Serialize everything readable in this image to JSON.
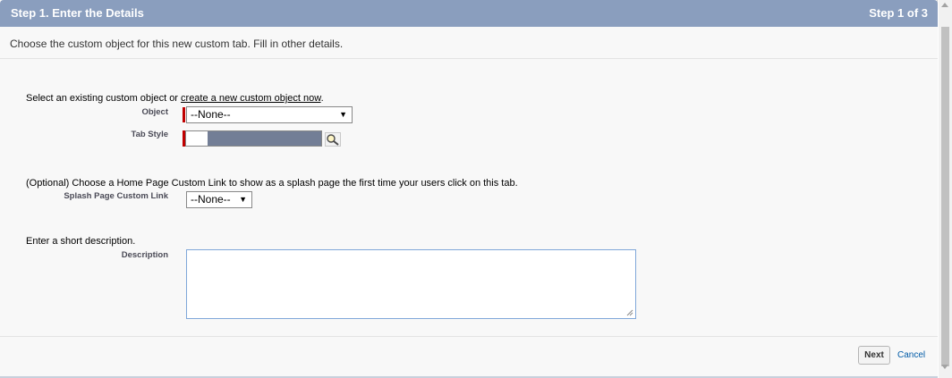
{
  "header": {
    "title": "Step 1. Enter the Details",
    "step": "Step 1 of 3"
  },
  "intro": "Choose the custom object for this new custom tab. Fill in other details.",
  "object_section": {
    "prompt_prefix": "Select an existing custom object or ",
    "prompt_link": "create a new custom object now",
    "prompt_suffix": ".",
    "object_label": "Object",
    "object_value": "--None--",
    "tab_style_label": "Tab Style"
  },
  "splash_section": {
    "prompt": "(Optional) Choose a Home Page Custom Link to show as a splash page the first time your users click on this tab.",
    "label": "Splash Page Custom Link",
    "value": "--None--"
  },
  "description_section": {
    "prompt": "Enter a short description.",
    "label": "Description",
    "value": ""
  },
  "footer": {
    "next_label": "Next",
    "cancel_label": "Cancel"
  },
  "icons": {
    "select_arrow": "dropdown-arrow-icon",
    "lookup": "lookup-icon",
    "required": "required-marker"
  },
  "colors": {
    "header_bg": "#8a9ebe",
    "required": "#c00000",
    "tab_style_swatch": "#737e96",
    "link": "#015ba7"
  }
}
